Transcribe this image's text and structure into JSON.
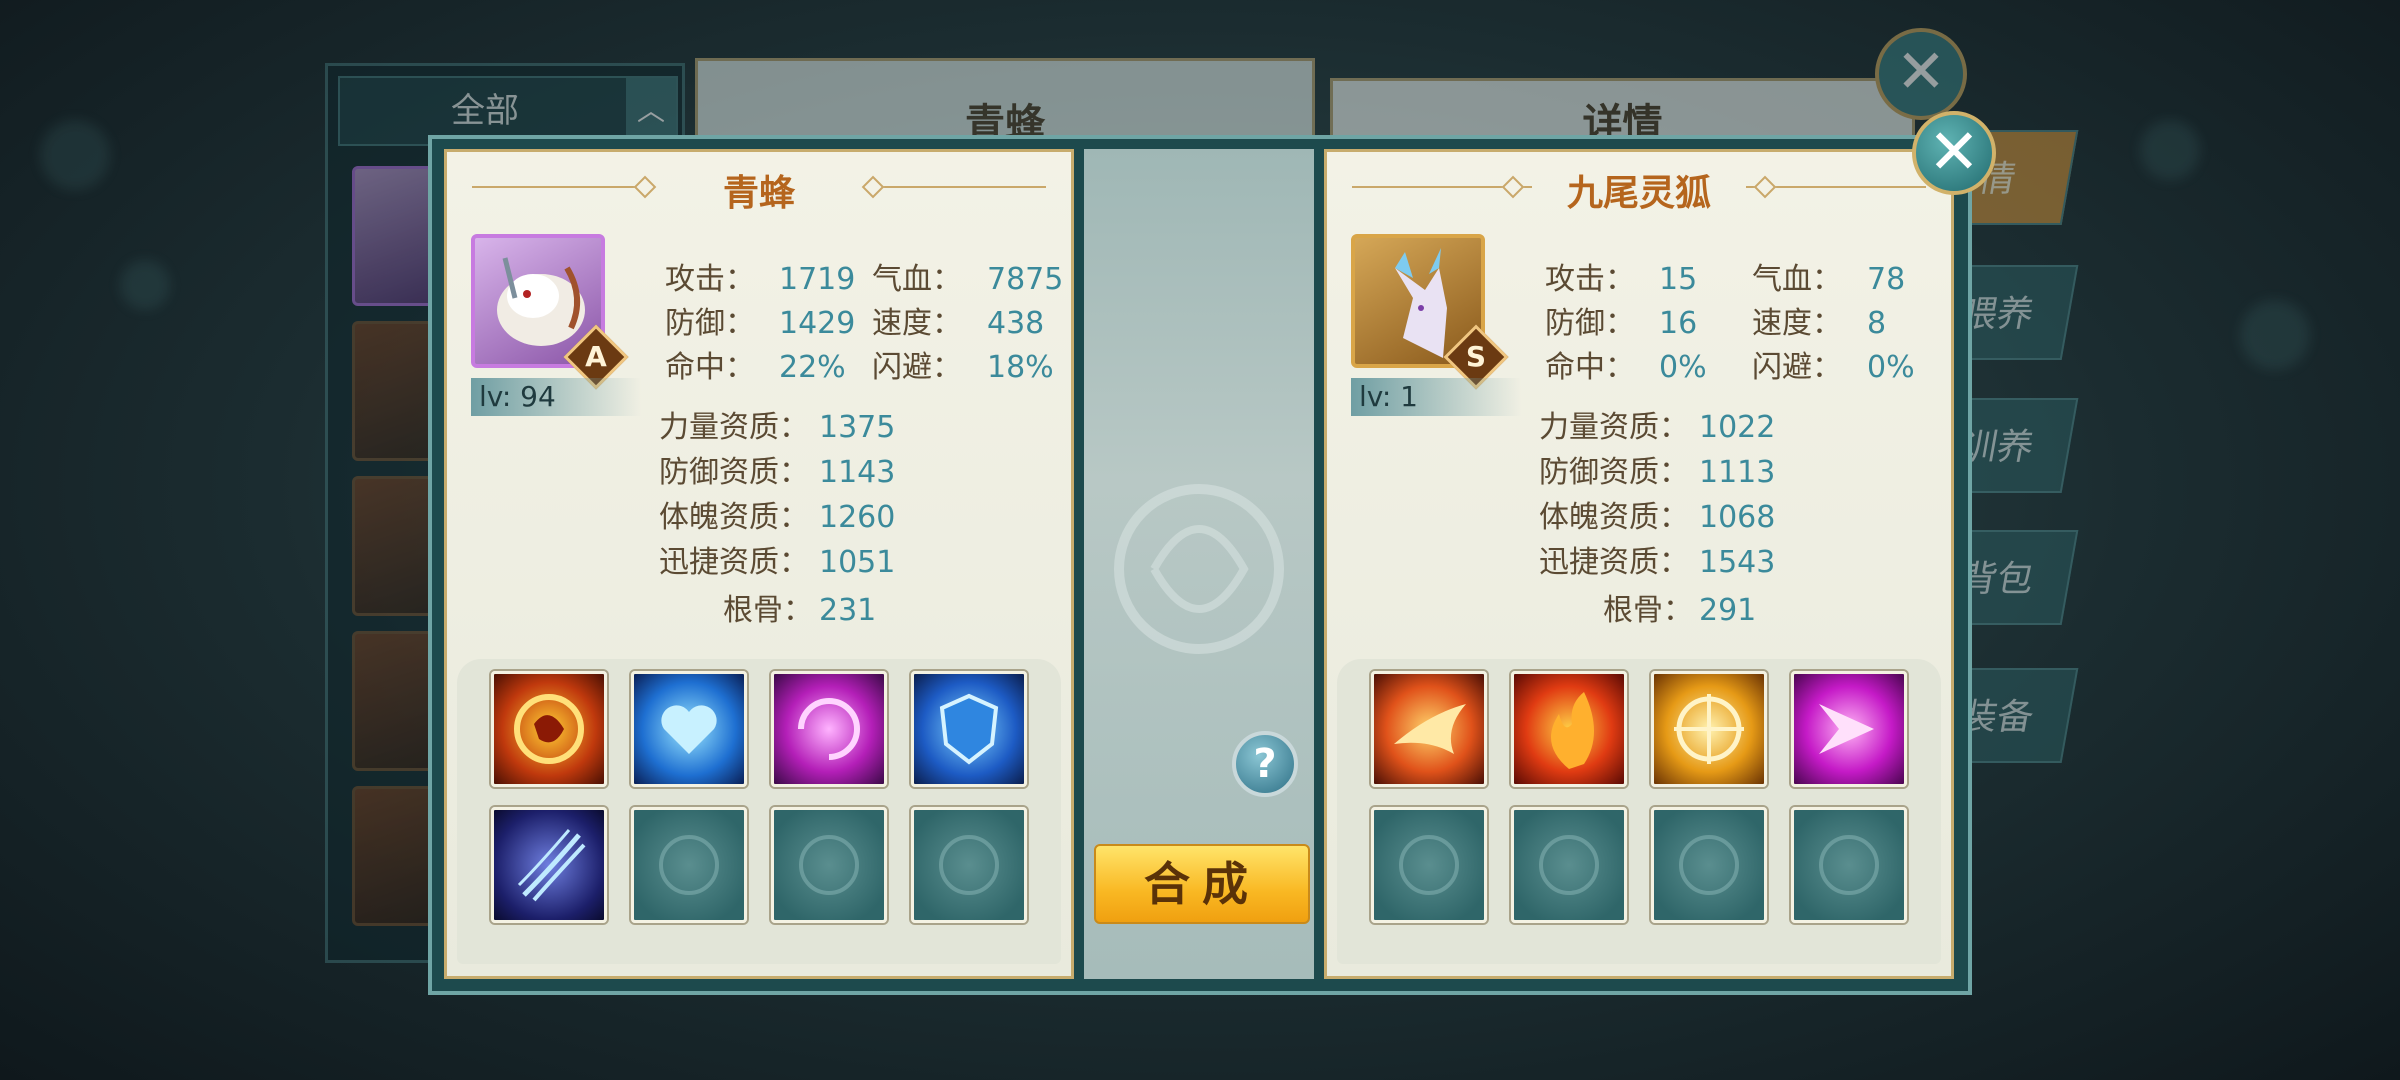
{
  "background": {
    "list_filter_label": "全部",
    "center_title": "青蜂",
    "right_title": "详情",
    "tabs": [
      "情",
      "喂养",
      "训养",
      "背包",
      "装备"
    ]
  },
  "merge_dialog": {
    "left_pet": {
      "name": "青蜂",
      "grade": "A",
      "level": "lv: 94",
      "stats": [
        {
          "label": "攻击：",
          "value": "1719"
        },
        {
          "label": "气血：",
          "value": "7875"
        },
        {
          "label": "防御：",
          "value": "1429"
        },
        {
          "label": "速度：",
          "value": "438"
        },
        {
          "label": "命中：",
          "value": "22%"
        },
        {
          "label": "闪避：",
          "value": "18%"
        }
      ],
      "aptitudes": [
        {
          "label": "力量资质：",
          "value": "1375"
        },
        {
          "label": "防御资质：",
          "value": "1143"
        },
        {
          "label": "体魄资质：",
          "value": "1260"
        },
        {
          "label": "迅捷资质：",
          "value": "1051"
        },
        {
          "label": "根骨：",
          "value": "231"
        }
      ],
      "skills": [
        "fire-orb-skill-icon",
        "ice-heart-skill-icon",
        "purple-vortex-skill-icon",
        "blue-shield-skill-icon",
        "claw-slash-skill-icon",
        "empty",
        "empty",
        "empty"
      ]
    },
    "right_pet": {
      "name": "九尾灵狐",
      "grade": "S",
      "level": "lv: 1",
      "stats": [
        {
          "label": "攻击：",
          "value": "15"
        },
        {
          "label": "气血：",
          "value": "78"
        },
        {
          "label": "防御：",
          "value": "16"
        },
        {
          "label": "速度：",
          "value": "8"
        },
        {
          "label": "命中：",
          "value": "0%"
        },
        {
          "label": "闪避：",
          "value": "0%"
        }
      ],
      "aptitudes": [
        {
          "label": "力量资质：",
          "value": "1022"
        },
        {
          "label": "防御资质：",
          "value": "1113"
        },
        {
          "label": "体魄资质：",
          "value": "1068"
        },
        {
          "label": "迅捷资质：",
          "value": "1543"
        },
        {
          "label": "根骨：",
          "value": "291"
        }
      ],
      "skills": [
        "phoenix-skill-icon",
        "flame-skill-icon",
        "golden-wheel-skill-icon",
        "pink-arrow-skill-icon",
        "empty",
        "empty",
        "empty",
        "empty"
      ]
    },
    "help_label": "?",
    "merge_button_label": "合成",
    "close_label": "✕"
  },
  "colors": {
    "title_orange": "#b5651d",
    "value_teal": "#3b8a9b",
    "merge_yellow": "#f9b823",
    "panel_teal": "#1d4a4d"
  }
}
